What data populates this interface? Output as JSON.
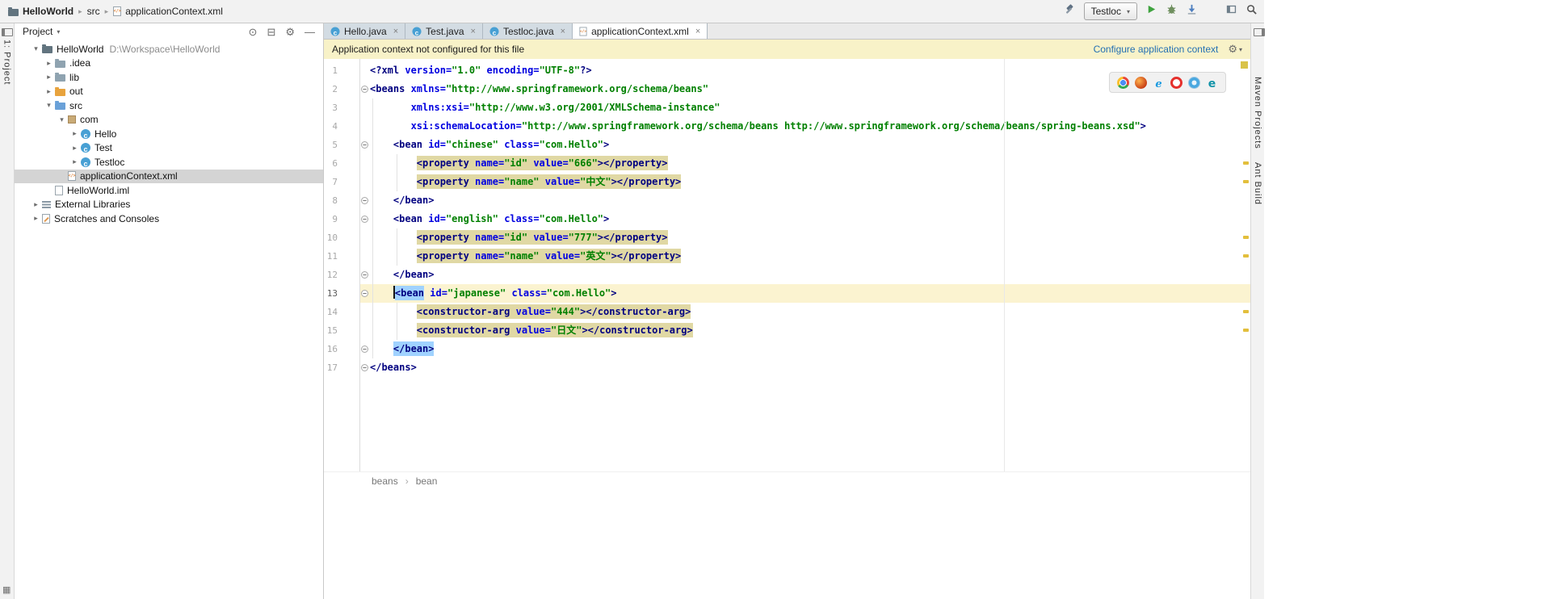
{
  "icons": {
    "caret_down": "▾",
    "chevron_expanded": "▾",
    "chevron_collapsed": "▸",
    "crumb_separator": "▸",
    "path_separator": "›",
    "close": "×",
    "fold": "−",
    "locate": "⊙",
    "collapse_all": "⊟",
    "settings": "⚙",
    "hide": "—",
    "switcher": "▦"
  },
  "toolbar": {
    "breadcrumbs": [
      {
        "label": "HelloWorld",
        "icon": "project"
      },
      {
        "label": "src",
        "icon": null
      },
      {
        "label": "applicationContext.xml",
        "icon": "xml"
      }
    ],
    "run_config_label": "Testloc"
  },
  "left_stripe": {
    "label": "1: Project"
  },
  "right_stripe": {
    "labels": [
      "Maven Projects",
      "Ant Build"
    ]
  },
  "project": {
    "title": "Project",
    "tree": [
      {
        "label": "HelloWorld",
        "hint": "D:\\Workspace\\HelloWorld",
        "icon": "project",
        "level": 0,
        "chevron": "exp",
        "selected": false
      },
      {
        "label": ".idea",
        "icon": "folder",
        "level": 1,
        "chevron": "col",
        "selected": false
      },
      {
        "label": "lib",
        "icon": "folder",
        "level": 1,
        "chevron": "col",
        "selected": false
      },
      {
        "label": "out",
        "icon": "folder-excluded",
        "level": 1,
        "chevron": "col",
        "selected": false
      },
      {
        "label": "src",
        "icon": "folder-src",
        "level": 1,
        "chevron": "exp",
        "selected": false
      },
      {
        "label": "com",
        "icon": "package",
        "level": 2,
        "chevron": "exp",
        "selected": false
      },
      {
        "label": "Hello",
        "icon": "class",
        "level": 3,
        "chevron": "col",
        "selected": false
      },
      {
        "label": "Test",
        "icon": "class",
        "level": 3,
        "chevron": "col",
        "selected": false
      },
      {
        "label": "Testloc",
        "icon": "class",
        "level": 3,
        "chevron": "col",
        "selected": false
      },
      {
        "label": "applicationContext.xml",
        "icon": "xml",
        "level": 2,
        "chevron": "none",
        "selected": true
      },
      {
        "label": "HelloWorld.iml",
        "icon": "iml",
        "level": 1,
        "chevron": "none",
        "selected": false
      },
      {
        "label": "External Libraries",
        "icon": "libraries",
        "level": 0,
        "chevron": "col",
        "selected": false
      },
      {
        "label": "Scratches and Consoles",
        "icon": "scratches",
        "level": 0,
        "chevron": "col",
        "selected": false
      }
    ]
  },
  "editor": {
    "tabs": [
      {
        "label": "Hello.java",
        "icon": "class",
        "active": false
      },
      {
        "label": "Test.java",
        "icon": "class",
        "active": false
      },
      {
        "label": "Testloc.java",
        "icon": "class",
        "active": false
      },
      {
        "label": "applicationContext.xml",
        "icon": "xml",
        "active": true
      }
    ],
    "banner": {
      "message": "Application context not configured for this file",
      "action_label": "Configure application context"
    },
    "browsers": [
      "chrome",
      "firefox",
      "ie",
      "opera",
      "safari",
      "edge"
    ],
    "breadcrumbs": [
      "beans",
      "bean"
    ],
    "warning_lines": [
      6,
      7,
      10,
      11,
      14,
      15
    ],
    "code": {
      "lines": [
        {
          "n": 1,
          "tokens": [
            [
              "<?xml ",
              "tag"
            ],
            [
              "version",
              "attr"
            ],
            [
              "=",
              "attr"
            ],
            [
              "\"1.0\" ",
              "val"
            ],
            [
              "encoding",
              "attr"
            ],
            [
              "=",
              "attr"
            ],
            [
              "\"UTF-8\"",
              "val"
            ],
            [
              "?>",
              "tag"
            ]
          ]
        },
        {
          "n": 2,
          "fold": "start",
          "tokens": [
            [
              "<beans ",
              "tag"
            ],
            [
              "xmlns",
              "attr"
            ],
            [
              "=",
              "attr"
            ],
            [
              "\"http://www.springframework.org/schema/beans\"",
              "val"
            ]
          ]
        },
        {
          "n": 3,
          "tokens": [
            [
              "       ",
              "ws"
            ],
            [
              "xmlns:xsi",
              "attr"
            ],
            [
              "=",
              "attr"
            ],
            [
              "\"http://www.w3.org/2001/XMLSchema-instance\"",
              "val"
            ]
          ]
        },
        {
          "n": 4,
          "tokens": [
            [
              "       ",
              "ws"
            ],
            [
              "xsi:schemaLocation",
              "attr"
            ],
            [
              "=",
              "attr"
            ],
            [
              "\"http://www.springframework.org/schema/beans http://www.springframework.org/schema/beans/spring-beans.xsd\"",
              "val"
            ],
            [
              ">",
              "tag"
            ]
          ]
        },
        {
          "n": 5,
          "fold": "start",
          "tokens": [
            [
              "    ",
              "ws"
            ],
            [
              "<bean ",
              "tag"
            ],
            [
              "id",
              "attr"
            ],
            [
              "=",
              "attr"
            ],
            [
              "\"chinese\" ",
              "val"
            ],
            [
              "class",
              "attr"
            ],
            [
              "=",
              "attr"
            ],
            [
              "\"com.Hello\"",
              "val"
            ],
            [
              ">",
              "tag"
            ]
          ]
        },
        {
          "n": 6,
          "tokens": [
            [
              "        ",
              "ws"
            ],
            [
              "<property ",
              "tag",
              "tan"
            ],
            [
              "name",
              "attr",
              "tan"
            ],
            [
              "=",
              "attr",
              "tan"
            ],
            [
              "\"id\" ",
              "val",
              "tan"
            ],
            [
              "value",
              "attr",
              "tan"
            ],
            [
              "=",
              "attr",
              "tan"
            ],
            [
              "\"666\"",
              "val",
              "tan"
            ],
            [
              "></property>",
              "tag",
              "tan"
            ]
          ]
        },
        {
          "n": 7,
          "tokens": [
            [
              "        ",
              "ws"
            ],
            [
              "<property ",
              "tag",
              "tan"
            ],
            [
              "name",
              "attr",
              "tan"
            ],
            [
              "=",
              "attr",
              "tan"
            ],
            [
              "\"name\" ",
              "val",
              "tan"
            ],
            [
              "value",
              "attr",
              "tan"
            ],
            [
              "=",
              "attr",
              "tan"
            ],
            [
              "\"中文\"",
              "val",
              "tan"
            ],
            [
              "></property>",
              "tag",
              "tan"
            ]
          ]
        },
        {
          "n": 8,
          "fold": "end",
          "tokens": [
            [
              "    ",
              "ws"
            ],
            [
              "</bean>",
              "tag"
            ]
          ]
        },
        {
          "n": 9,
          "fold": "start",
          "tokens": [
            [
              "    ",
              "ws"
            ],
            [
              "<bean ",
              "tag"
            ],
            [
              "id",
              "attr"
            ],
            [
              "=",
              "attr"
            ],
            [
              "\"english\" ",
              "val"
            ],
            [
              "class",
              "attr"
            ],
            [
              "=",
              "attr"
            ],
            [
              "\"com.Hello\"",
              "val"
            ],
            [
              ">",
              "tag"
            ]
          ]
        },
        {
          "n": 10,
          "tokens": [
            [
              "        ",
              "ws"
            ],
            [
              "<property ",
              "tag",
              "tan"
            ],
            [
              "name",
              "attr",
              "tan"
            ],
            [
              "=",
              "attr",
              "tan"
            ],
            [
              "\"id\" ",
              "val",
              "tan"
            ],
            [
              "value",
              "attr",
              "tan"
            ],
            [
              "=",
              "attr",
              "tan"
            ],
            [
              "\"777\"",
              "val",
              "tan"
            ],
            [
              "></property>",
              "tag",
              "tan"
            ]
          ]
        },
        {
          "n": 11,
          "tokens": [
            [
              "        ",
              "ws"
            ],
            [
              "<property ",
              "tag",
              "tan"
            ],
            [
              "name",
              "attr",
              "tan"
            ],
            [
              "=",
              "attr",
              "tan"
            ],
            [
              "\"name\" ",
              "val",
              "tan"
            ],
            [
              "value",
              "attr",
              "tan"
            ],
            [
              "=",
              "attr",
              "tan"
            ],
            [
              "\"英文\"",
              "val",
              "tan"
            ],
            [
              "></property>",
              "tag",
              "tan"
            ]
          ]
        },
        {
          "n": 12,
          "fold": "end",
          "tokens": [
            [
              "    ",
              "ws"
            ],
            [
              "</bean>",
              "tag"
            ]
          ]
        },
        {
          "n": 13,
          "fold": "start",
          "caret": true,
          "tokens": [
            [
              "    ",
              "ws"
            ],
            [
              "",
              "caret"
            ],
            [
              "<bean",
              "tag",
              "blue"
            ],
            [
              " ",
              "ws"
            ],
            [
              "id",
              "attr"
            ],
            [
              "=",
              "attr"
            ],
            [
              "\"japanese\" ",
              "val"
            ],
            [
              "class",
              "attr"
            ],
            [
              "=",
              "attr"
            ],
            [
              "\"com.Hello\"",
              "val"
            ],
            [
              ">",
              "tag"
            ]
          ]
        },
        {
          "n": 14,
          "tokens": [
            [
              "        ",
              "ws"
            ],
            [
              "<constructor-arg ",
              "tag",
              "tan"
            ],
            [
              "value",
              "attr",
              "tan"
            ],
            [
              "=",
              "attr",
              "tan"
            ],
            [
              "\"444\"",
              "val",
              "tan"
            ],
            [
              "></constructor-arg>",
              "tag",
              "tan"
            ]
          ]
        },
        {
          "n": 15,
          "tokens": [
            [
              "        ",
              "ws"
            ],
            [
              "<constructor-arg ",
              "tag",
              "tan"
            ],
            [
              "value",
              "attr",
              "tan"
            ],
            [
              "=",
              "attr",
              "tan"
            ],
            [
              "\"日文\"",
              "val",
              "tan"
            ],
            [
              "></constructor-arg>",
              "tag",
              "tan"
            ]
          ]
        },
        {
          "n": 16,
          "fold": "end",
          "tokens": [
            [
              "    ",
              "ws"
            ],
            [
              "</bean>",
              "tag",
              "blue"
            ]
          ]
        },
        {
          "n": 17,
          "fold": "end",
          "tokens": [
            [
              "</beans>",
              "tag"
            ]
          ]
        }
      ]
    }
  }
}
